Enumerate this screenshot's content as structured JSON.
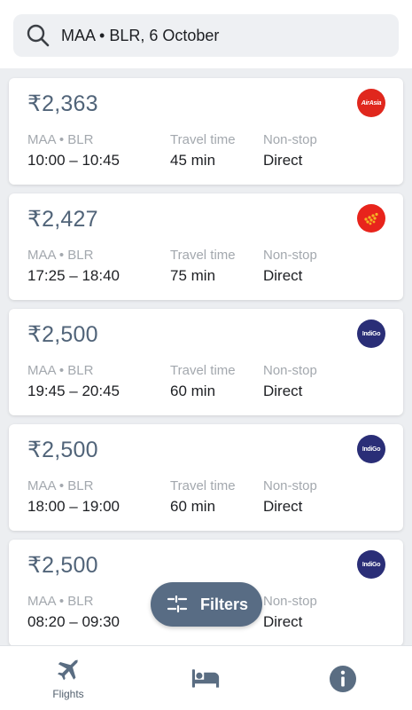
{
  "search": {
    "query": "MAA • BLR, 6 October",
    "icon": "search-icon"
  },
  "labels": {
    "route": "MAA • BLR",
    "travel_time": "Travel time",
    "stops": "Non-stop"
  },
  "flights": [
    {
      "price": "₹2,363",
      "airline_logo": "airasia-logo",
      "logo_text": "AirAsia",
      "times": "10:00 – 10:45",
      "duration": "45 min",
      "stop_type": "Direct"
    },
    {
      "price": "₹2,427",
      "airline_logo": "spicejet-logo",
      "logo_text": "",
      "times": "17:25 – 18:40",
      "duration": "75 min",
      "stop_type": "Direct"
    },
    {
      "price": "₹2,500",
      "airline_logo": "indigo-logo",
      "logo_text": "IndiGo",
      "times": "19:45 – 20:45",
      "duration": "60 min",
      "stop_type": "Direct"
    },
    {
      "price": "₹2,500",
      "airline_logo": "indigo-logo",
      "logo_text": "IndiGo",
      "times": "18:00 – 19:00",
      "duration": "60 min",
      "stop_type": "Direct"
    },
    {
      "price": "₹2,500",
      "airline_logo": "indigo-logo",
      "logo_text": "IndiGo",
      "times": "08:20 – 09:30",
      "duration": "",
      "stop_type": "Direct"
    }
  ],
  "filters_button": {
    "label": "Filters",
    "icon": "sliders-icon"
  },
  "bottom_nav": {
    "flights_label": "Flights",
    "items": [
      "airplane-icon",
      "bed-icon",
      "info-icon"
    ]
  },
  "colors": {
    "price": "#516479",
    "airasia": "#e0271d",
    "spicejet": "#e8241c",
    "indigo": "#2a2e77",
    "fab": "#586c84",
    "nav_icon": "#5a6d82"
  }
}
